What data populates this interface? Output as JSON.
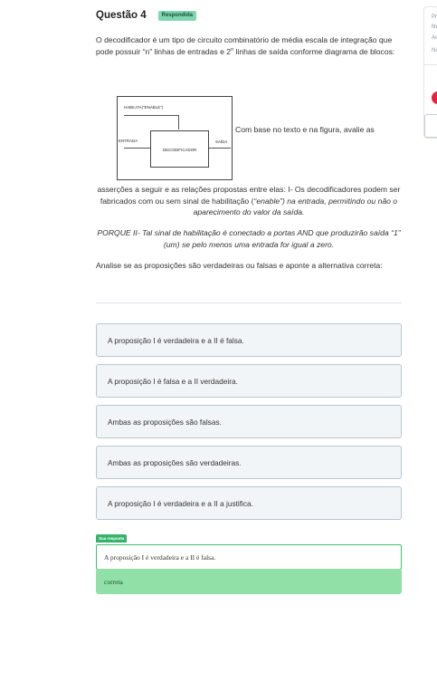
{
  "question": {
    "title": "Questão 4",
    "status_badge": "Respondida",
    "intro_before_sup": "O decodificador é um tipo de circuito combinatório de média escala de integração que pode possuir “n” linhas de entradas e 2",
    "intro_sup": "n",
    "intro_after_sup": " linhas de saída conforme diagrama de blocos:",
    "figure_caption": "Com base no texto e na figura, avalie as",
    "body_plain": "asserções a seguir e as relações propostas entre elas: I- Os decodificadores podem ser fabricados com ou sem sinal de habilitação (",
    "body_italic": "“enable”) na entrada, permitindo ou não o aparecimento do valor da saída.",
    "porque": "PORQUE II- Tal sinal de habilitação é conectado a portas AND que produzirão saída “1” (um) se pelo menos uma entrada for igual a zero.",
    "analise": "Analise se as proposições são verdadeiras ou falsas e aponte a alternativa correta:"
  },
  "diagram": {
    "enable_label": "HABILITA(“ENABLE”)",
    "input_label": "ENTRADA",
    "output_label": "SAÍDA",
    "block_label": "DECODIFICADOR"
  },
  "options": [
    "A proposição I é verdadeira e a II é falsa.",
    "A proposição I é falsa e a II verdadeira.",
    "Ambas as proposições são falsas.",
    "Ambas as proposições são verdadeiras.",
    "A proposição I é verdadeira e a II a justifica."
  ],
  "answer": {
    "tag": "Sua resposta",
    "text": "A proposição I é verdadeira e a II é falsa."
  },
  "feedback": {
    "text": "correta"
  },
  "side_panel": {
    "line1": "Pr",
    "line2": "fin",
    "line3": "Ac",
    "line4": "No"
  }
}
